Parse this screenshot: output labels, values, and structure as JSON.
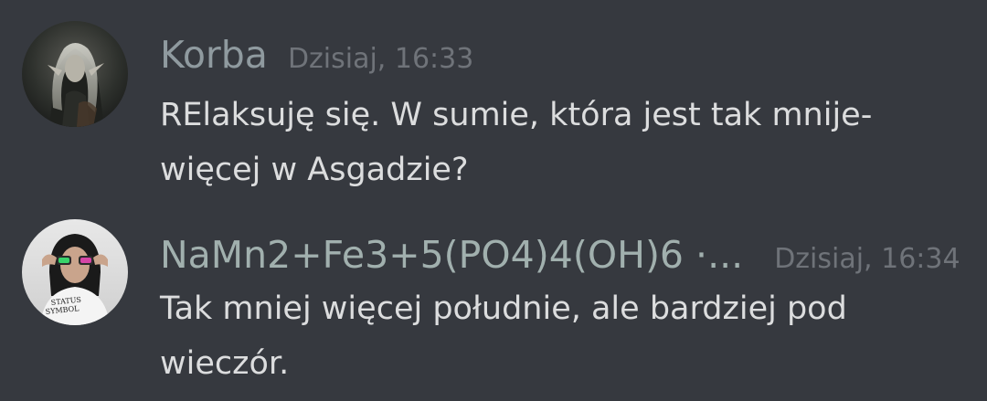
{
  "messages": [
    {
      "username": "Korba",
      "timestamp": "Dzisiaj, 16:33",
      "text": "RElaksuję się. W sumie, która jest tak mnije-więcej w Asgadzie?",
      "name_color": "#8f9a9f"
    },
    {
      "username": "NaMn2+Fe3+5(PO4)4(OH)6 ·...",
      "timestamp": "Dzisiaj, 16:34",
      "text": "Tak mniej więcej południe, ale bardziej pod wieczór.",
      "name_color": "#a1b0ae"
    }
  ],
  "theme": {
    "background": "#36393f",
    "text": "#dcddde",
    "timestamp": "#6f7379"
  }
}
